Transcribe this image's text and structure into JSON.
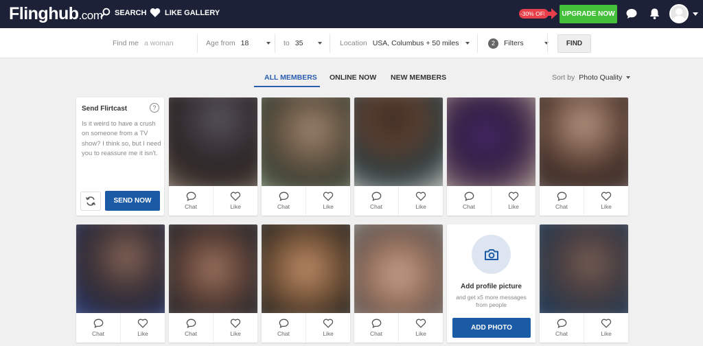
{
  "header": {
    "logo_main": "Flinghub",
    "logo_domain": ".com",
    "search_label": "SEARCH",
    "like_gallery_label": "LIKE GALLERY",
    "discount_badge": "-30% OFF",
    "upgrade_label": "UPGRADE NOW",
    "colors": {
      "nav_bg": "#1d2138",
      "upgrade": "#44c03a",
      "discount": "#e8404b"
    }
  },
  "filters": {
    "find_me_label": "Find me",
    "find_me_value": "a woman",
    "age_from_label": "Age from",
    "age_from_value": "18",
    "age_to_label": "to",
    "age_to_value": "35",
    "location_label": "Location",
    "location_value": "USA, Columbus + 50 miles",
    "filters_count": "2",
    "filters_label": "Filters",
    "find_label": "FIND"
  },
  "tabs": [
    {
      "label": "ALL MEMBERS",
      "active": true
    },
    {
      "label": "ONLINE NOW",
      "active": false
    },
    {
      "label": "NEW MEMBERS",
      "active": false
    }
  ],
  "sort": {
    "label": "Sort by",
    "value": "Photo Quality"
  },
  "flirtcast": {
    "title": "Send Flirtcast",
    "help": "?",
    "message": "Is it weird to have a crush on someone from a TV show? I think so, but I need you to reassure me it isn't.",
    "send_label": "SEND NOW"
  },
  "card_actions": {
    "chat": "Chat",
    "like": "Like"
  },
  "add_photo": {
    "title": "Add profile picture",
    "subtitle": "and get x5 more messages from people",
    "button": "ADD PHOTO"
  },
  "accent_color": "#1b5ba6"
}
